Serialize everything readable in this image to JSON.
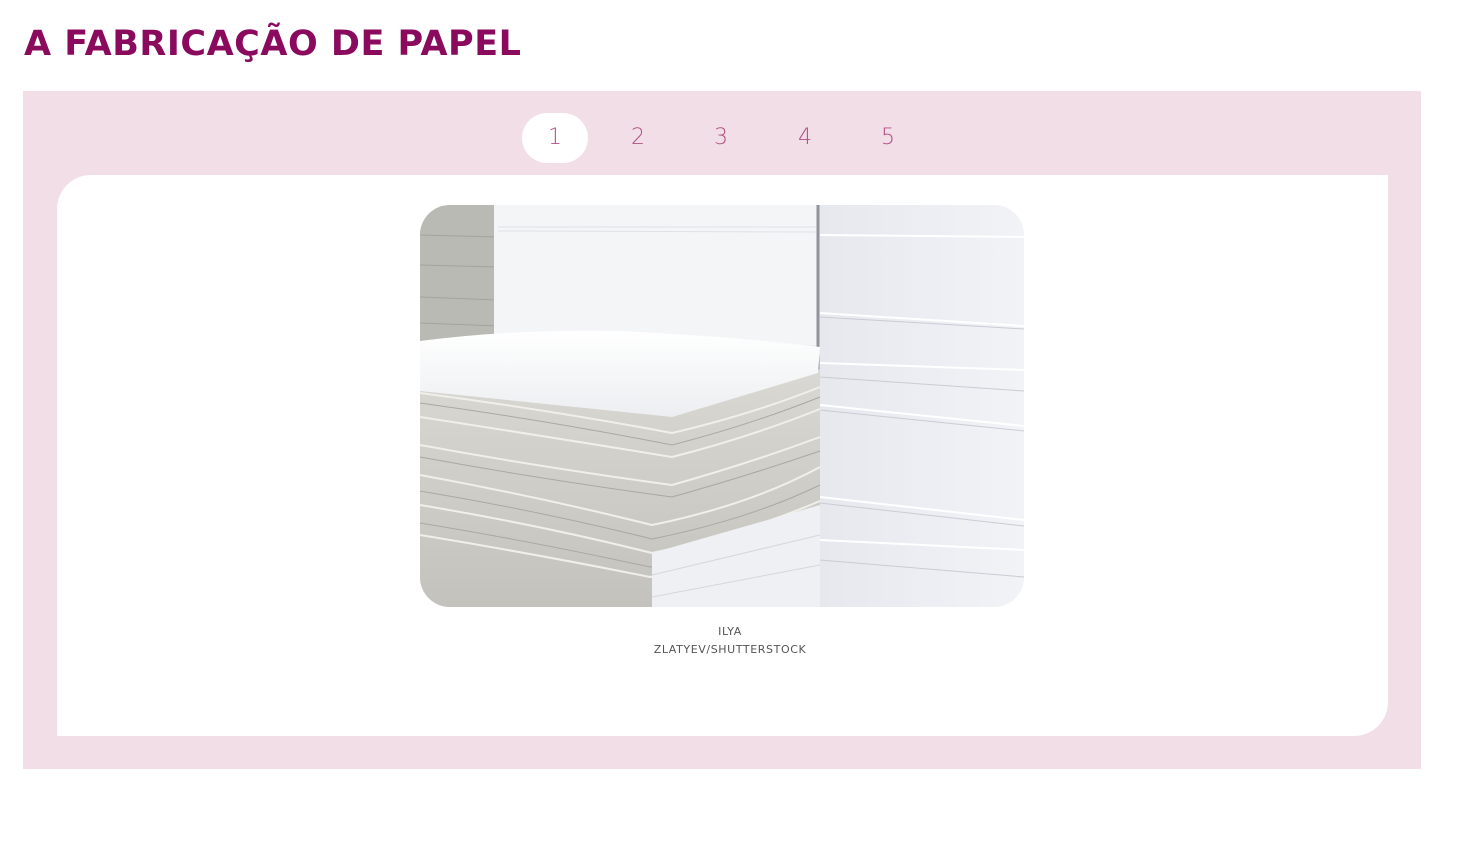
{
  "page": {
    "title": "A FABRICAÇÃO DE PAPEL"
  },
  "carousel": {
    "tabs": [
      {
        "label": "1",
        "active": true
      },
      {
        "label": "2",
        "active": false
      },
      {
        "label": "3",
        "active": false
      },
      {
        "label": "4",
        "active": false
      },
      {
        "label": "5",
        "active": false
      }
    ],
    "slide": {
      "caption_line1": "ILYA",
      "caption_line2": "ZLATYEV/SHUTTERSTOCK"
    }
  },
  "colors": {
    "title": "#8a0a5e",
    "carousel_bg": "#f1dee7",
    "tab_text": "#b34f86"
  }
}
